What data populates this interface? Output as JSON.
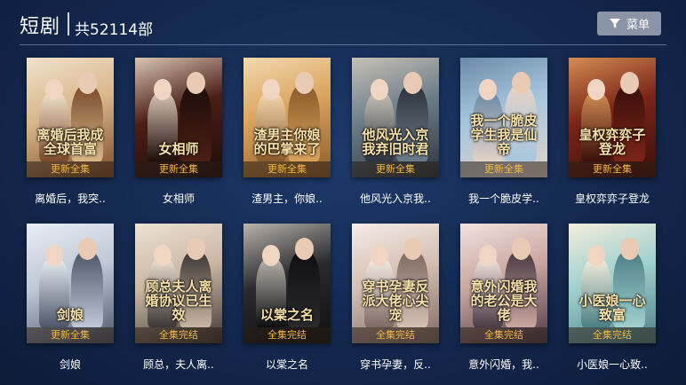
{
  "header": {
    "title": "短剧",
    "count": "共52114部",
    "menu_label": "菜单",
    "menu_icon": "filter-icon"
  },
  "accent": "#f3b640",
  "items": [
    {
      "title": "离婚后，我突..",
      "badge": "更新全集",
      "poster_text": "离婚后我成全球首富",
      "palette": [
        "#d8b68a",
        "#7b4a2a",
        "#f1e2cc"
      ]
    },
    {
      "title": "女相师",
      "badge": "更新全集",
      "poster_text": "女相师",
      "palette": [
        "#4b1e14",
        "#1c0d0a",
        "#d9c6b5"
      ]
    },
    {
      "title": "渣男主，你娘..",
      "badge": "更新全集",
      "poster_text": "渣男主你娘的巴掌来了",
      "palette": [
        "#d9a35c",
        "#8b5a2b",
        "#f4d9b0"
      ]
    },
    {
      "title": "他风光入京我..",
      "badge": "更新全集",
      "poster_text": "他风光入京我弃旧时君",
      "palette": [
        "#6d7d88",
        "#2b333d",
        "#c7c1b6"
      ]
    },
    {
      "title": "我一个脆皮学..",
      "badge": "更新全集",
      "poster_text": "我一个脆皮学生我是仙帝",
      "palette": [
        "#a7c6de",
        "#e3d3c8",
        "#6b8aa6"
      ]
    },
    {
      "title": "皇权弈弈子登龙",
      "badge": "更新全集",
      "poster_text": "皇权弈弈子登龙",
      "palette": [
        "#7a2418",
        "#3a0f0b",
        "#d28c52"
      ]
    },
    {
      "title": "剑娘",
      "badge": "更新全集",
      "poster_text": "剑娘",
      "palette": [
        "#bfc8d6",
        "#4c5668",
        "#e9eef4"
      ]
    },
    {
      "title": "顾总，夫人离..",
      "badge": "全集完结",
      "poster_text": "顾总夫人离婚协议已生效",
      "palette": [
        "#c9b7a3",
        "#3b3534",
        "#eee2d4"
      ]
    },
    {
      "title": "以棠之名",
      "badge": "全集完结",
      "poster_text": "以棠之名",
      "palette": [
        "#2a2a2e",
        "#0f0f12",
        "#b9b3ad"
      ]
    },
    {
      "title": "穿书孕妻，反..",
      "badge": "全集完结",
      "poster_text": "穿书孕妻反派大佬心尖宠",
      "palette": [
        "#d4bfb3",
        "#7e6a63",
        "#f5ede6"
      ]
    },
    {
      "title": "意外闪婚，我..",
      "badge": "全集完结",
      "poster_text": "意外闪婚我的老公是大佬",
      "palette": [
        "#caa6a0",
        "#4a3a45",
        "#f1e3de"
      ]
    },
    {
      "title": "小医娘一心致..",
      "badge": "全集完结",
      "poster_text": "小医娘一心致富",
      "palette": [
        "#9fd1cf",
        "#4c7f86",
        "#f4eddc"
      ]
    }
  ]
}
